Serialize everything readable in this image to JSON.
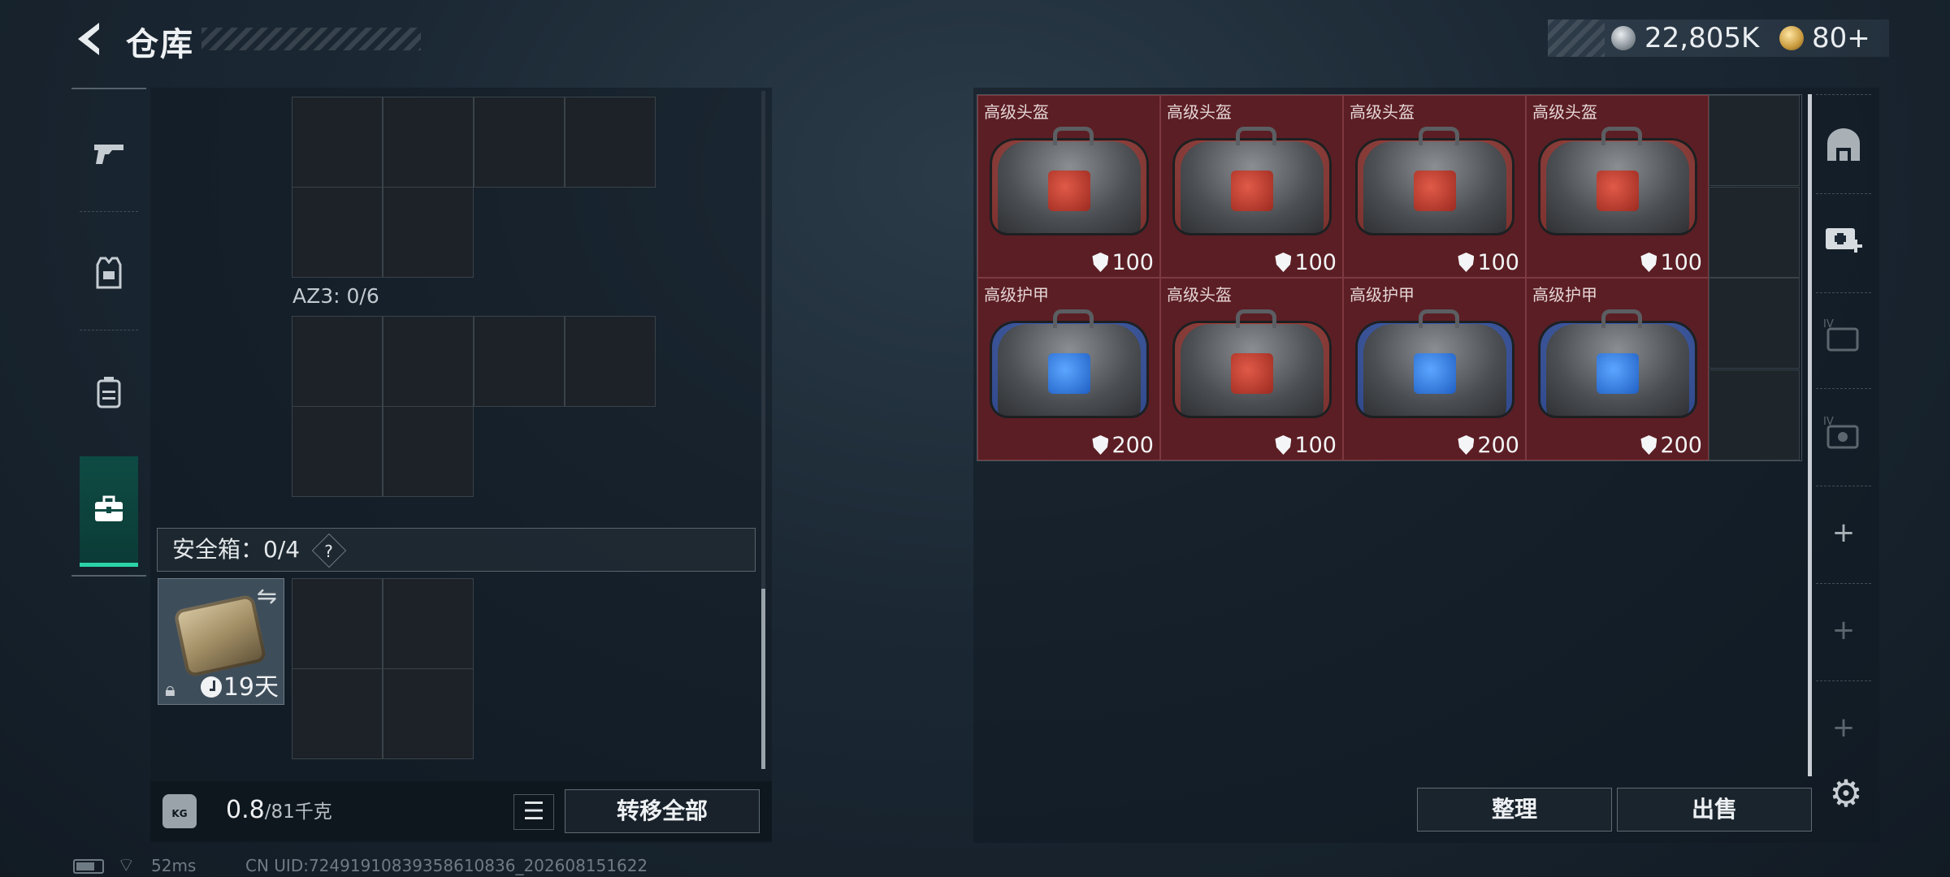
{
  "header": {
    "back_icon": "back-chevron-icon",
    "title": "仓库",
    "currency_silver": "22,805K",
    "currency_gold": "80+"
  },
  "left_rail": [
    {
      "name": "weapon-tab",
      "icon": "pistol-icon"
    },
    {
      "name": "armor-tab",
      "icon": "vest-icon"
    },
    {
      "name": "backpack-tab",
      "icon": "backpack-icon"
    },
    {
      "name": "case-tab",
      "icon": "briefcase-icon",
      "active": true
    }
  ],
  "left_panel": {
    "az3_label": "AZ3: 0/6",
    "safe_box_label": "安全箱：0/4",
    "help_glyph": "?",
    "safe_item": {
      "time_left": "19天"
    },
    "weight_icon_label": "KG",
    "weight_current": "0.8",
    "weight_max": "/81千克",
    "transfer_all": "转移全部"
  },
  "stash": {
    "items": [
      {
        "name": "高级头盔",
        "value": "100",
        "color": "red"
      },
      {
        "name": "高级头盔",
        "value": "100",
        "color": "red"
      },
      {
        "name": "高级头盔",
        "value": "100",
        "color": "red"
      },
      {
        "name": "高级头盔",
        "value": "100",
        "color": "red"
      },
      {
        "name": "高级护甲",
        "value": "200",
        "color": "blue"
      },
      {
        "name": "高级头盔",
        "value": "100",
        "color": "red"
      },
      {
        "name": "高级护甲",
        "value": "200",
        "color": "blue"
      },
      {
        "name": "高级护甲",
        "value": "200",
        "color": "blue"
      }
    ],
    "sort_label": "整理",
    "sell_label": "出售"
  },
  "right_rail": [
    {
      "name": "stash-tab-1",
      "icon": "arch-icon",
      "dim": false
    },
    {
      "name": "stash-tab-2",
      "icon": "medkit-add-icon",
      "dim": false
    },
    {
      "name": "stash-tab-3",
      "icon": "iv-case-icon",
      "dim": true
    },
    {
      "name": "stash-tab-4",
      "icon": "iv-case-icon",
      "dim": true
    },
    {
      "name": "add-stash-tab-1",
      "icon": "plus-icon",
      "dim": false
    },
    {
      "name": "add-stash-tab-2",
      "icon": "plus-icon",
      "dim": true
    },
    {
      "name": "add-stash-tab-3",
      "icon": "plus-icon",
      "dim": true
    }
  ],
  "status_bar": {
    "ping": "52ms",
    "uid": "CN UID:72491910839358610836_202608151622"
  }
}
